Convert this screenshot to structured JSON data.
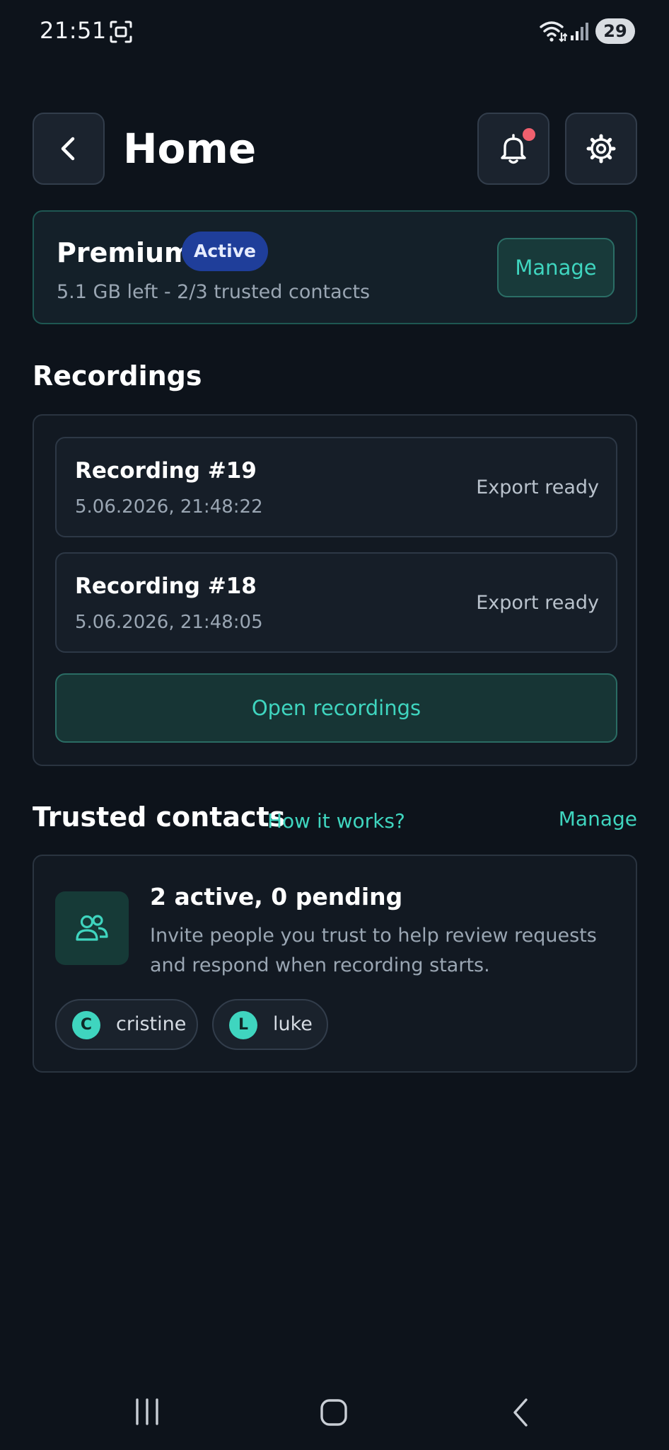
{
  "status_bar": {
    "time": "21:51",
    "battery": "29",
    "icons": [
      "screenshot-icon",
      "wifi-icon",
      "signal-icon"
    ]
  },
  "header": {
    "title": "Home",
    "has_notification": true,
    "icons": [
      "back-arrow-icon",
      "bell-icon",
      "gear-icon"
    ]
  },
  "premium": {
    "plan": "Premium",
    "badge": "Active",
    "details": "5.1 GB left - 2/3 trusted contacts",
    "manage_label": "Manage"
  },
  "recordings": {
    "heading": "Recordings",
    "items": [
      {
        "title": "Recording #19",
        "date": "5.06.2026, 21:48:22",
        "status": "Export ready"
      },
      {
        "title": "Recording #18",
        "date": "5.06.2026, 21:48:05",
        "status": "Export ready"
      }
    ],
    "open_label": "Open recordings"
  },
  "trusted_contacts": {
    "heading": "Trusted contacts",
    "how_it_works": "How it works?",
    "manage_label": "Manage",
    "summary": "2 active, 0 pending",
    "description": "Invite people you trust to help review requests and respond when recording starts.",
    "contacts": [
      {
        "initial": "C",
        "name": "cristine"
      },
      {
        "initial": "L",
        "name": "luke"
      }
    ]
  },
  "colors": {
    "background": "#0d131b",
    "accent": "#3fd5bf",
    "badge": "#1f3e9a",
    "notification": "#f0606e"
  },
  "nav_bar": {
    "icons": [
      "recents-icon",
      "home-icon",
      "back-icon"
    ]
  }
}
